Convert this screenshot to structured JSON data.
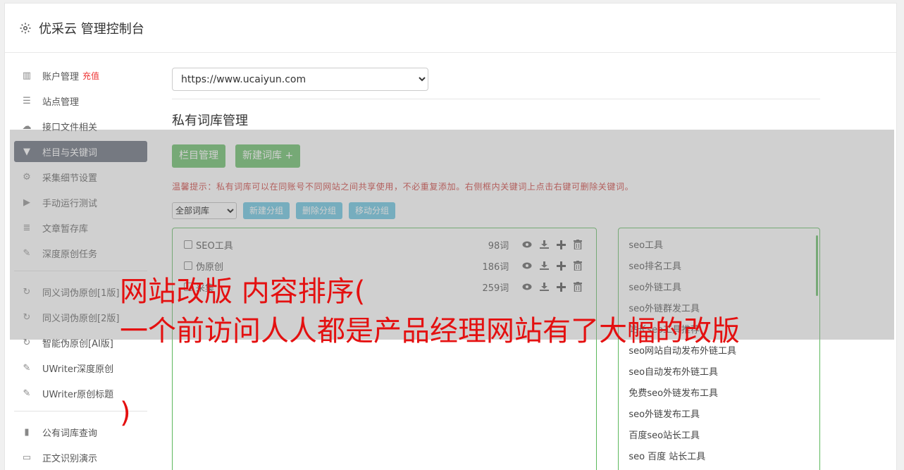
{
  "app": {
    "title": "优采云 管理控制台"
  },
  "sidebar": {
    "items": [
      {
        "label": "账户管理",
        "badge": "充值",
        "icon": "bar-chart-icon"
      },
      {
        "label": "站点管理",
        "icon": "server-icon"
      },
      {
        "label": "接口文件相关",
        "icon": "cloud-upload-icon"
      },
      {
        "label": "栏目与关键词",
        "icon": "filter-icon",
        "active": true
      },
      {
        "label": "采集细节设置",
        "icon": "cogs-icon"
      },
      {
        "label": "手动运行测试",
        "icon": "play-circle-icon"
      },
      {
        "label": "文章暂存库",
        "icon": "database-icon"
      },
      {
        "label": "深度原创任务",
        "icon": "edit-icon"
      }
    ],
    "items2": [
      {
        "label": "同义词伪原创[1版]",
        "icon": "refresh-icon"
      },
      {
        "label": "同义词伪原创[2版]",
        "icon": "refresh-icon"
      },
      {
        "label": "智能伪原创[AI版]",
        "icon": "refresh-icon"
      },
      {
        "label": "UWriter深度原创",
        "icon": "edit-icon"
      },
      {
        "label": "UWriter原创标题",
        "icon": "edit-icon"
      }
    ],
    "items3": [
      {
        "label": "公有词库查询",
        "icon": "book-icon"
      },
      {
        "label": "正文识别演示",
        "icon": "monitor-icon"
      }
    ]
  },
  "main": {
    "site_select_value": "https://www.ucaiyun.com",
    "section_title": "私有词库管理",
    "btn_column_manage": "栏目管理",
    "btn_new_library": "新建词库 +",
    "tip": "温馨提示：私有词库可以在同账号不同网站之间共享使用，不必重复添加。右侧框内关键词上点击右键可删除关键词。",
    "group_select_value": "全部词库",
    "btn_new_group": "新建分组",
    "btn_delete_group": "删除分组",
    "btn_move_group": "移动分组",
    "libraries": [
      {
        "name": "SEO工具",
        "count": "98词"
      },
      {
        "name": "伪原创",
        "count": "186词"
      },
      {
        "name": "采集",
        "count": "259词"
      }
    ],
    "keywords": [
      "seo工具",
      "seo排名工具",
      "seo外链工具",
      "seo外链群发工具",
      "站长seo工具推荐",
      "seo网站自动发布外链工具",
      "seo自动发布外链工具",
      "免费seo外链发布工具",
      "seo外链发布工具",
      "百度seo站长工具",
      "seo 百度 站长工具"
    ]
  },
  "overlay": {
    "line1": "网站改版 内容排序(",
    "line2": "一个前访问人人都是产品经理网站有了大幅的改版",
    "line3": ")"
  },
  "colors": {
    "accent_green": "#5cb85c",
    "accent_blue": "#5bc0de",
    "warning_red": "#c9302c",
    "headline_red": "#e41010"
  }
}
